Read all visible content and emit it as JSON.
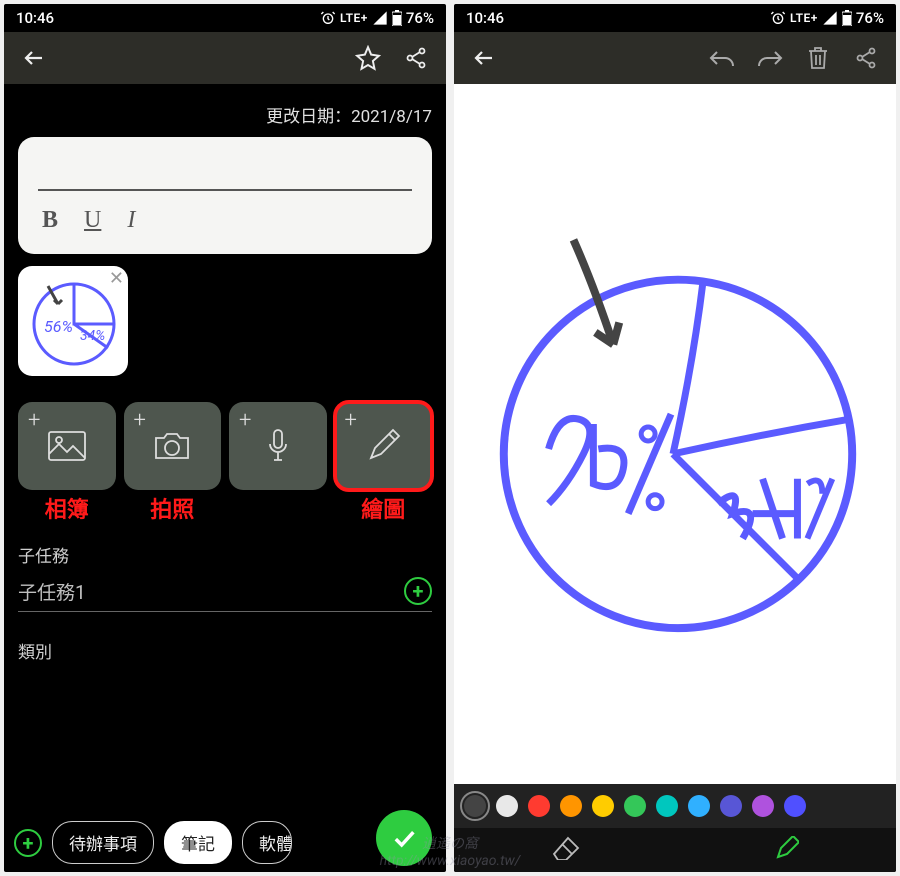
{
  "status": {
    "time": "10:46",
    "network": "LTE+",
    "battery": "76%"
  },
  "left": {
    "date_label": "更改日期：2021/8/17",
    "format": {
      "bold": "B",
      "underline": "U",
      "italic": "I"
    },
    "attach_labels": [
      "相簿",
      "拍照",
      "",
      "繪圖"
    ],
    "subtask_heading": "子任務",
    "subtask_placeholder": "子任務1",
    "category_heading": "類別",
    "chips": [
      "待辦事項",
      "筆記",
      "軟體"
    ]
  },
  "right": {
    "drawing_values": {
      "slice1": "56%",
      "slice2": "34%"
    },
    "palette": [
      "#444444",
      "#e8e8e8",
      "#ff3b30",
      "#ff9500",
      "#ffcc00",
      "#34c759",
      "#00c7be",
      "#30b0ff",
      "#5856d6",
      "#af52de",
      "#5050ff"
    ],
    "selected_palette_index": 0
  },
  "watermark": {
    "line1": "逍遙の窩",
    "line2": "http://www.xiaoyao.tw/"
  }
}
